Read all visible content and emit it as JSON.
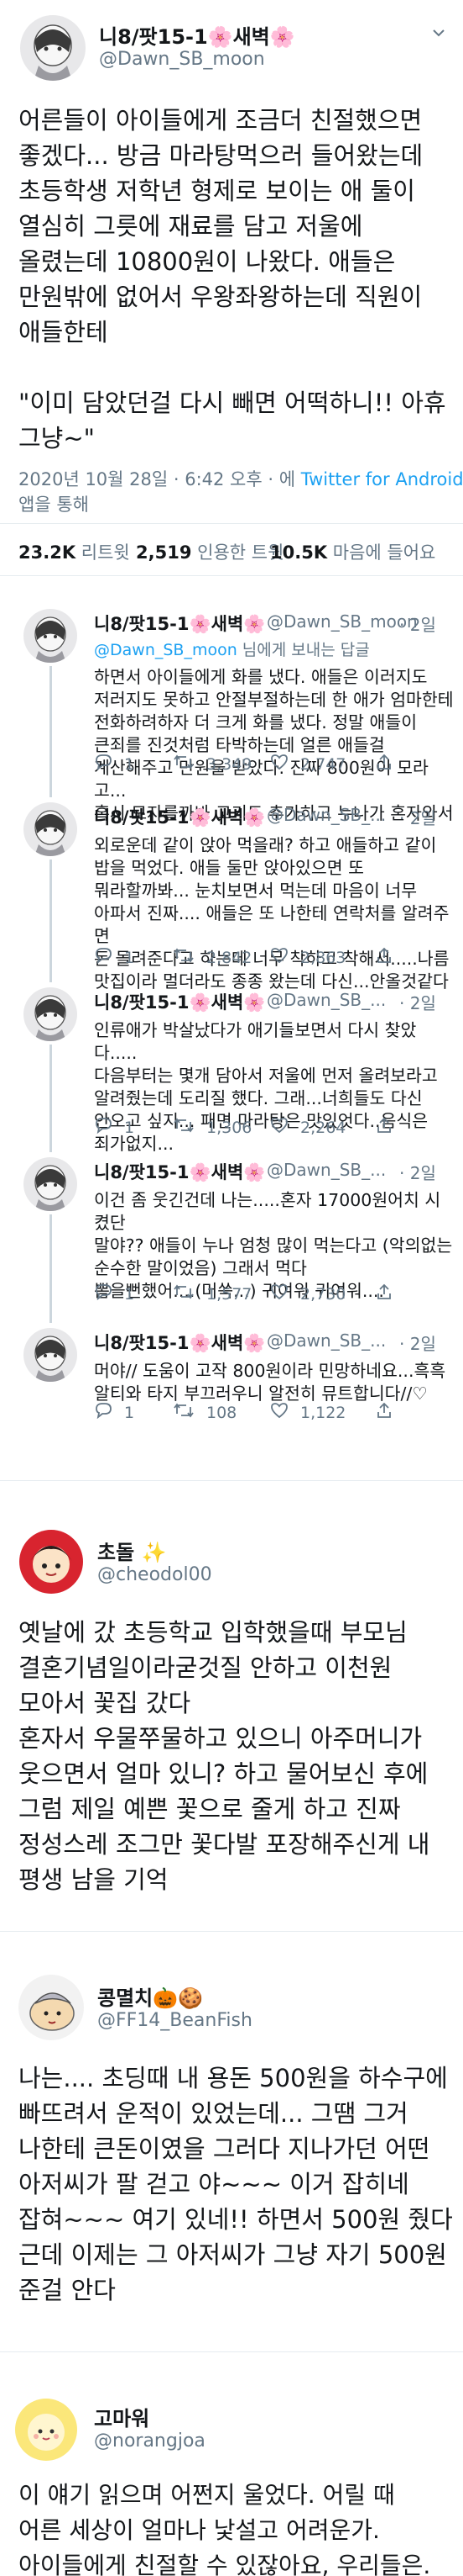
{
  "main_tweet": {
    "display_name": "니8/팟15-1🌸새벽🌸",
    "handle": "@Dawn_SB_moon",
    "body": "어른들이 아이들에게 조금더 친절했으면\n좋겠다... 방금 마라탕먹으러 들어왔는데\n초등학생 저학년 형제로 보이는 애 둘이\n열심히 그릇에 재료를 담고 저울에\n올렸는데 10800원이 나왔다. 애들은\n만원밖에 없어서 우왕좌왕하는데 직원이\n애들한테\n\n\"이미 담았던걸 다시 빼면 어떡하니!! 아휴\n그냥~\"",
    "time_prefix": "2020년 10월 28일 · 6:42 오후 · 에 ",
    "client": "Twitter for Android",
    "time_suffix": "앱을 통해",
    "retweets_count": "23.2K",
    "retweets_label": "리트윗",
    "quotes_count": "2,519",
    "quotes_label": "인용한 트윗",
    "likes_count": "10.5K",
    "likes_label": "마음에 들어요"
  },
  "replies": [
    {
      "display_name": "니8/팟15-1🌸새벽🌸",
      "handle": "@Dawn_SB_moon",
      "time": "· 2일",
      "reply_to_mention": "@Dawn_SB_moon",
      "reply_to_suffix": "님에게 보내는 답글",
      "body": "하면서 아이들에게 화를 냈다. 애들은 이러지도\n저러지도 못하고 안절부절하는데 한 애가 엄마한테\n전화하려하자 더 크게 화를 냈다. 정말 애들이\n큰죄를 진것처럼 타박하는데 얼른 애들걸\n계산해주고 만원을 받았다. 진짜 800원이 모라고...\n혹시 모자를까봐 고기도 추가하고 누나가 혼자와서",
      "replies": "1",
      "retweets": "3,349",
      "likes": "2,747"
    },
    {
      "display_name": "니8/팟15-1🌸새벽🌸",
      "handle": "@Dawn_SB_...",
      "time": "· 2일",
      "body": "외로운데 같이 앉아 먹을래? 하고 애들하고 같이\n밥을 먹었다. 애들 둘만 앉아있으면 또\n뭐라할까봐... 눈치보면서 먹는데 마음이 너무\n아파서 진짜.... 애들은 또 나한테 연락처를 알려주면\n돈 돌려준다고 하는데 너무 착하고 착해서.....나름\n맛집이라 멀더라도 종종 왔는데 다신...안올것같다",
      "replies": "1",
      "retweets": "2,842",
      "likes": "2,863"
    },
    {
      "display_name": "니8/팟15-1🌸새벽🌸",
      "handle": "@Dawn_SB_...",
      "time": "· 2일",
      "body": "인류애가 박살났다가 애기들보면서 다시 찾았다.....\n다음부터는 몇개 담아서 저울에 먼저 올려보라고\n알려줬는데 도리질 했다. 그래...너희들도 다신\n안오고 싶지... 패면 마라탕은 맛있엇다..음식은\n죄가없지...",
      "replies": "1",
      "retweets": "1,306",
      "likes": "2,264"
    },
    {
      "display_name": "니8/팟15-1🌸새벽🌸",
      "handle": "@Dawn_SB_...",
      "time": "· 2일",
      "body": "이건 좀 웃긴건데 나는.....혼자 17000원어치 시켰단\n말야?? 애들이 누나 엄청 많이 먹는다고 (악의없는\n순수한 말이었음) 그래서 먹다\n뽐을뻔했어....(머쓱...) 귀여워 귀여워....",
      "replies": "1",
      "retweets": "1,577",
      "likes": "2,730"
    },
    {
      "display_name": "니8/팟15-1🌸새벽🌸",
      "handle": "@Dawn_SB_...",
      "time": "· 2일",
      "body": "머야// 도움이 고작 800원이라 민망하네요...흑흑\n알티와 타지 부끄러우니 알전히 뮤트합니다//♡",
      "replies": "1",
      "retweets": "108",
      "likes": "1,122"
    }
  ],
  "other_tweets": [
    {
      "display_name": "초돌 ✨",
      "handle": "@cheodol00",
      "body": "옛날에 갔 초등학교 입학했을때 부모님\n결혼기념일이라굳것질 안하고 이천원\n모아서 꽃집 갔다\n혼자서 우물쭈물하고 있으니 아주머니가\n웃으면서 얼마 있니? 하고 물어보신 후에\n그럼 제일 예쁜 꽃으로 줄게 하고 진짜\n정성스레 조그만 꽃다발 포장해주신게 내\n평생 남을 기억"
    },
    {
      "display_name": "콩멸치🎃🍪",
      "handle": "@FF14_BeanFish",
      "body": "나는.... 초딩때 내 용돈 500원을 하수구에\n빠뜨려서 운적이 있었는데... 그땜 그거\n나한테 큰돈이였을 그러다 지나가던 어떤\n아저씨가 팔 걷고 야~~~ 이거 잡히네\n잡혀~~~ 여기 있네!! 하면서 500원 줬다\n근데 이제는 그 아저씨가 그냥 자기 500원\n준걸 안다"
    },
    {
      "display_name": "고마워",
      "handle": "@norangjoa",
      "body": "이 얘기 읽으며 어쩐지 울었다. 어릴 때\n어른 세상이 얼마나 낯설고 어려운가.\n아이들에게 친절할 수 있잖아요, 우리들은."
    }
  ],
  "colors": {
    "link": "#1da1f2",
    "muted": "#657786",
    "text": "#14171a",
    "divider": "#e6ecf0"
  },
  "icons": [
    "reply-icon",
    "retweet-icon",
    "like-icon",
    "share-icon",
    "caret-down-icon"
  ]
}
